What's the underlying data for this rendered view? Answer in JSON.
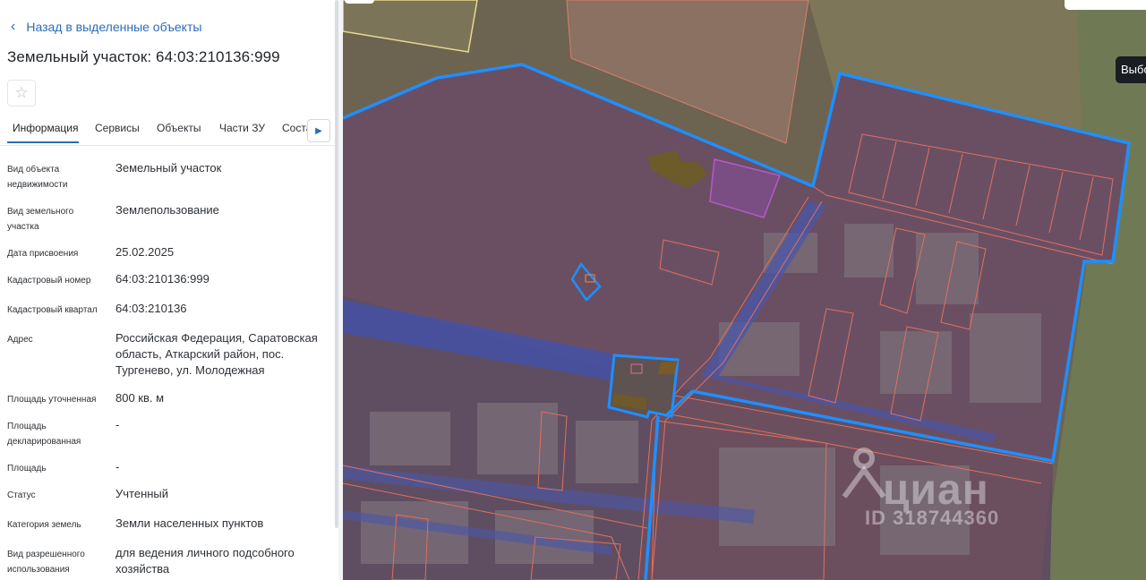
{
  "panel": {
    "back_label": "Назад в выделенные объекты",
    "back_icon": "chevron-left-icon",
    "title": "Земельный участок: 64:03:210136:999",
    "favorite_icon": "star-outline-icon",
    "tabs": [
      {
        "label": "Информация",
        "active": true
      },
      {
        "label": "Сервисы",
        "active": false
      },
      {
        "label": "Объекты",
        "active": false
      },
      {
        "label": "Части ЗУ",
        "active": false
      },
      {
        "label": "Соста",
        "active": false
      }
    ],
    "tabs_next_icon": "chevron-right-icon",
    "fields": [
      {
        "label": "Вид объекта недвижимости",
        "value": "Земельный участок"
      },
      {
        "label": "Вид земельного участка",
        "value": "Землепользование"
      },
      {
        "label": "Дата присвоения",
        "value": "25.02.2025"
      },
      {
        "label": "Кадастровый номер",
        "value": "64:03:210136:999"
      },
      {
        "label": "Кадастровый квартал",
        "value": "64:03:210136"
      },
      {
        "label": "Адрес",
        "value": "Российская Федерация, Саратовская область, Аткарский район, пос. Тургенево, ул. Молодежная"
      },
      {
        "label": "Площадь уточненная",
        "value": "800 кв. м"
      },
      {
        "label": "Площадь декларированная",
        "value": "-"
      },
      {
        "label": "Площадь",
        "value": "-"
      },
      {
        "label": "Статус",
        "value": "Учтенный"
      },
      {
        "label": "Категория земель",
        "value": "Земли населенных пунктов"
      },
      {
        "label": "Вид разрешенного использования",
        "value": "для ведения личного подсобного хозяйства"
      }
    ]
  },
  "map": {
    "select_button_label": "Выбо",
    "watermark_brand": "циан",
    "watermark_id": "ID 318744360",
    "colors": {
      "selected_parcel_outline": "#1e8fff",
      "parcel_outline": "#e0705f",
      "zone_fill": "#3c4ba8",
      "ground": "#7a6168"
    }
  }
}
